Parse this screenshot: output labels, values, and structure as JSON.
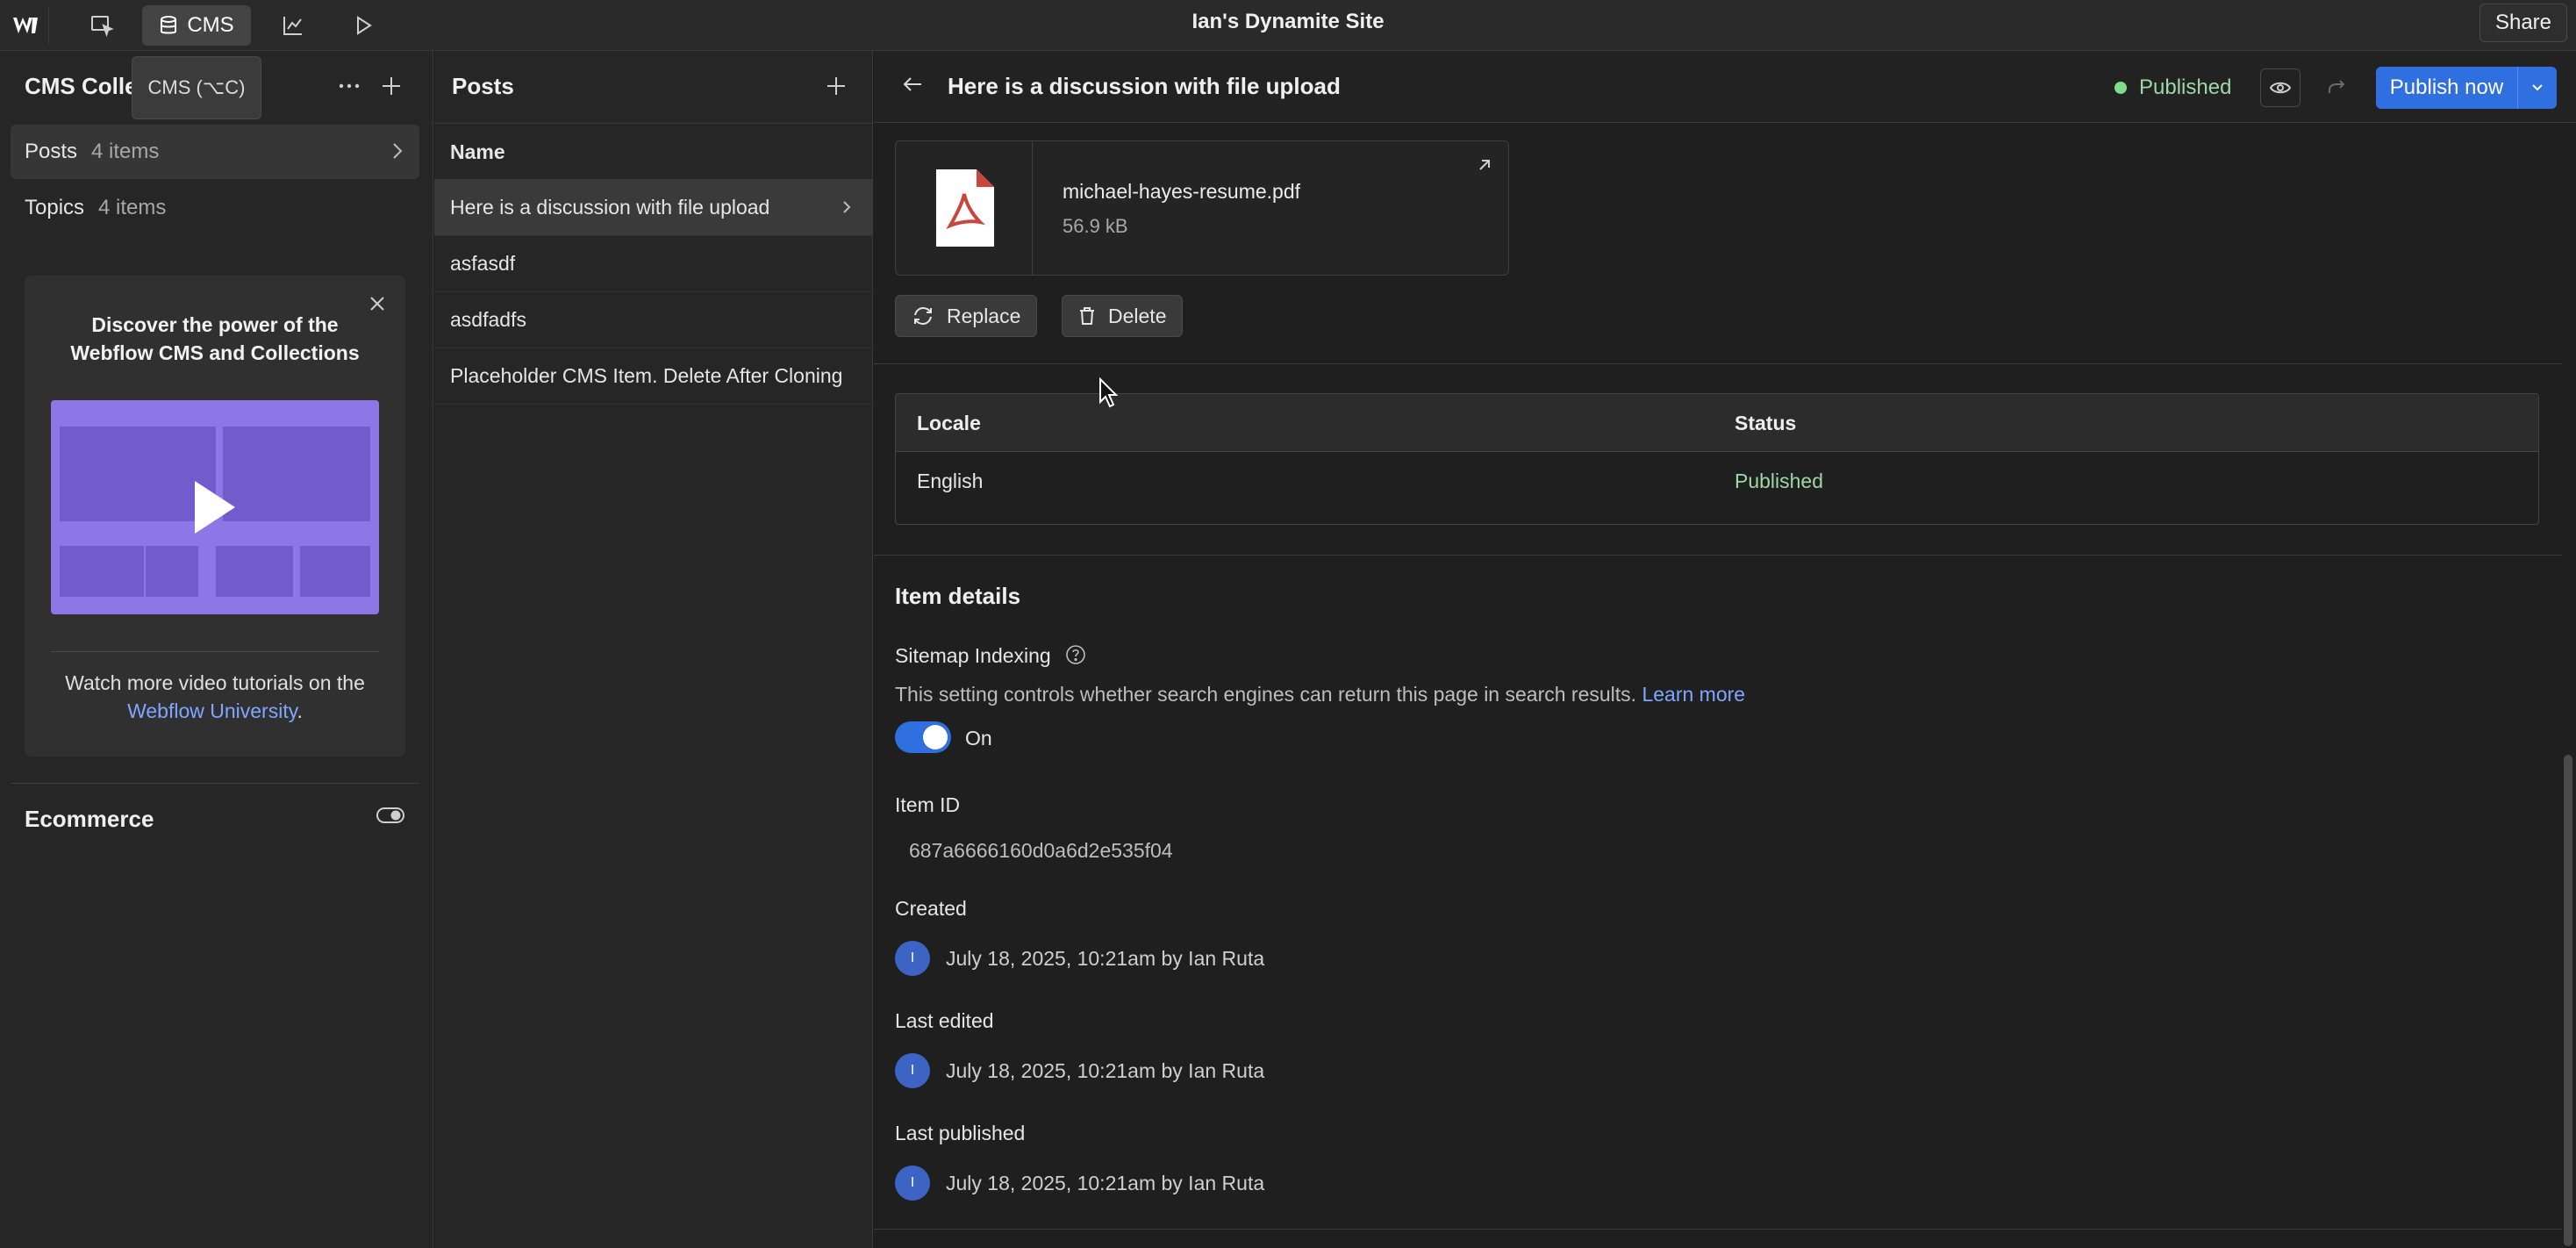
{
  "topbar": {
    "logo_icon": "webflow-logo-icon",
    "cms_label": "CMS",
    "site_title": "Ian's Dynamite Site",
    "share_label": "Share"
  },
  "tooltip": {
    "text": "CMS (⌥C)"
  },
  "sidebar": {
    "title": "CMS Collections",
    "collections": [
      {
        "name": "Posts",
        "count": "4 items"
      },
      {
        "name": "Topics",
        "count": "4 items"
      }
    ],
    "promo": {
      "title": "Discover the power of the Webflow CMS and Collections",
      "text_prefix": "Watch more video tutorials on the",
      "link_text": "Webflow University",
      "text_suffix": "."
    },
    "ecommerce_label": "Ecommerce"
  },
  "posts_panel": {
    "title": "Posts",
    "column_header": "Name",
    "rows": [
      "Here is a discussion with file upload",
      "asfasdf",
      "asdfadfs",
      "Placeholder CMS Item. Delete After Cloning"
    ]
  },
  "detail": {
    "title": "Here is a discussion with file upload",
    "status": "Published",
    "publish_label": "Publish now",
    "file": {
      "name": "michael-hayes-resume.pdf",
      "size": "56.9 kB"
    },
    "replace_label": "Replace",
    "delete_label": "Delete",
    "locale_table": {
      "headers": [
        "Locale",
        "Status"
      ],
      "rows": [
        [
          "English",
          "Published"
        ]
      ]
    },
    "item_details_title": "Item details",
    "sitemap_label": "Sitemap Indexing",
    "sitemap_help": "This setting controls whether search engines can return this page in search results.",
    "learn_more": "Learn more",
    "toggle_label": "On",
    "item_id_label": "Item ID",
    "item_id": "687a6666160d0a6d2e535f04",
    "created_label": "Created",
    "created_value": "July 18, 2025, 10:21am by Ian Ruta",
    "last_edited_label": "Last edited",
    "last_edited_value": "July 18, 2025, 10:21am by Ian Ruta",
    "last_published_label": "Last published",
    "last_published_value": "July 18, 2025, 10:21am by Ian Ruta",
    "avatar_initial": "I"
  },
  "colors": {
    "accent": "#2f6fe0",
    "published": "#9fd7a5",
    "link": "#7fa7ff"
  }
}
